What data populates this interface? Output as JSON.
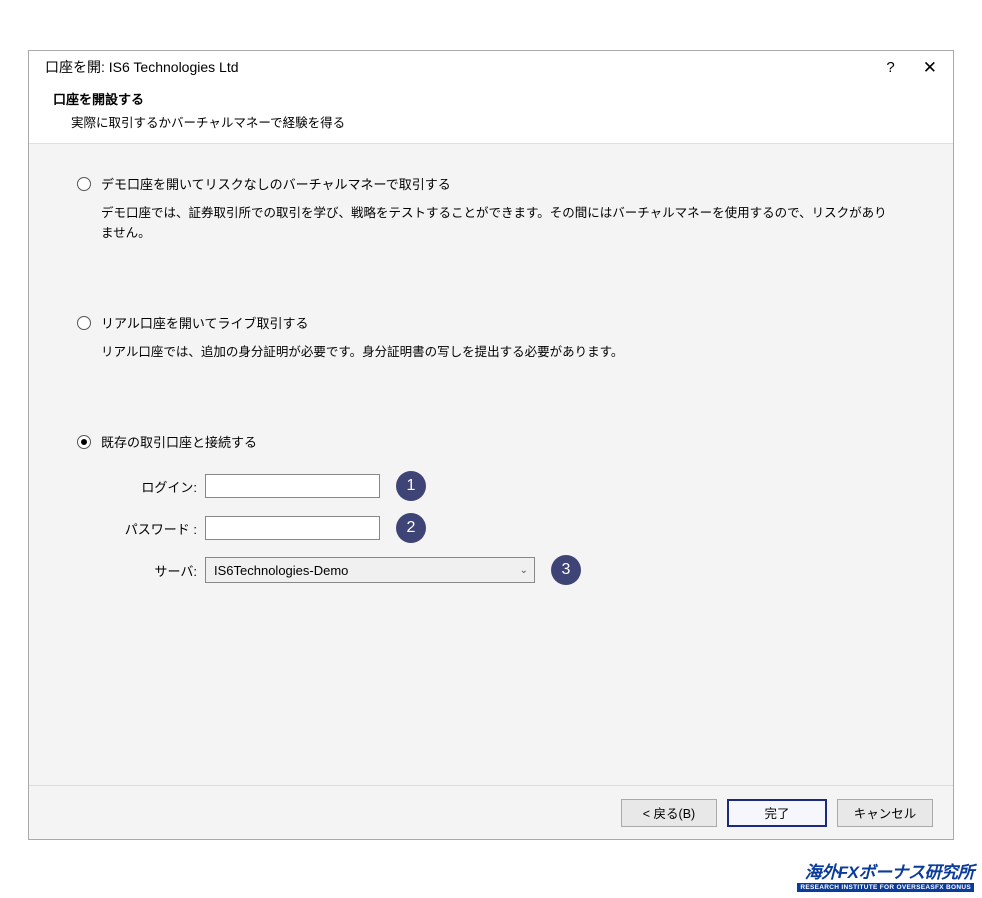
{
  "titlebar": {
    "title": "口座を開: IS6 Technologies Ltd"
  },
  "header": {
    "title": "口座を開設する",
    "subtitle": "実際に取引するかバーチャルマネーで経験を得る"
  },
  "options": {
    "demo": {
      "label": "デモ口座を開いてリスクなしのバーチャルマネーで取引する",
      "desc": "デモ口座では、証券取引所での取引を学び、戦略をテストすることができます。その間にはバーチャルマネーを使用するので、リスクがありません。"
    },
    "real": {
      "label": "リアル口座を開いてライブ取引する",
      "desc": "リアル口座では、追加の身分証明が必要です。身分証明書の写しを提出する必要があります。"
    },
    "existing": {
      "label": "既存の取引口座と接続する"
    }
  },
  "form": {
    "login_label": "ログイン:",
    "login_value": "",
    "password_label": "パスワード :",
    "password_value": "",
    "server_label": "サーバ:",
    "server_value": "IS6Technologies-Demo"
  },
  "badges": {
    "b1": "1",
    "b2": "2",
    "b3": "3"
  },
  "footer": {
    "back": "< 戻る(B)",
    "finish": "完了",
    "cancel": "キャンセル"
  },
  "watermark": {
    "top": "海外FXボーナス研究所",
    "bottom": "RESEARCH INSTITUTE FOR OVERSEASFX BONUS"
  }
}
